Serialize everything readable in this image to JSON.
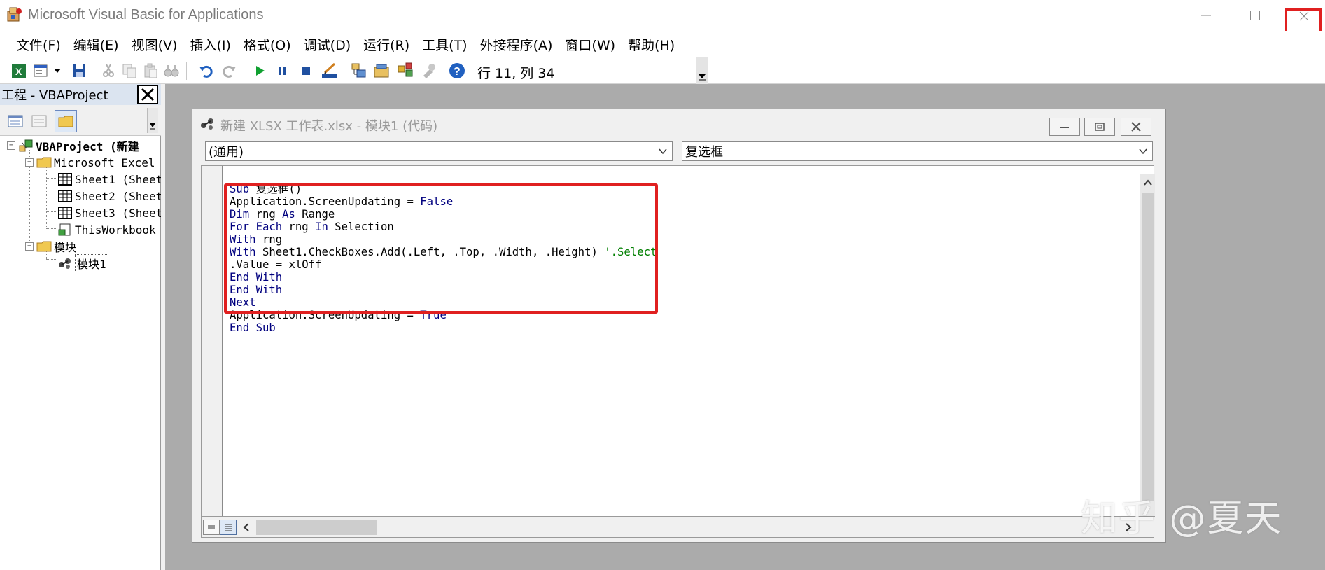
{
  "window": {
    "title": "Microsoft Visual Basic for Applications"
  },
  "menu": [
    "文件(F)",
    "编辑(E)",
    "视图(V)",
    "插入(I)",
    "格式(O)",
    "调试(D)",
    "运行(R)",
    "工具(T)",
    "外接程序(A)",
    "窗口(W)",
    "帮助(H)"
  ],
  "toolbar": {
    "cursor_position": "行 11, 列 34"
  },
  "project": {
    "title": "工程 - VBAProject",
    "tree": {
      "root": "VBAProject (新建",
      "excel_folder": "Microsoft Excel",
      "sheet1": "Sheet1 (Sheet",
      "sheet2": "Sheet2 (Sheet",
      "sheet3": "Sheet3 (Sheet",
      "workbook": "ThisWorkbook",
      "modules_folder": "模块",
      "module1": "模块1"
    }
  },
  "code_window": {
    "title": "新建 XLSX 工作表.xlsx - 模块1 (代码)",
    "object_combo": "(通用)",
    "procedure_combo": "复选框",
    "lines": [
      "Sub 复选框()",
      "Application.ScreenUpdating = False",
      "Dim rng As Range",
      "For Each rng In Selection",
      "With rng",
      "With Sheet1.CheckBoxes.Add(.Left, .Top, .Width, .Height) '.Select",
      ".Value = xlOff",
      "End With",
      "End With",
      "Next",
      "Application.ScreenUpdating = True",
      "End Sub"
    ]
  },
  "watermark": "知乎 @夏天",
  "colors": {
    "keyword": "#00007f",
    "comment": "#007f00",
    "highlight": "#e02020",
    "mdi_background": "#ababab"
  }
}
